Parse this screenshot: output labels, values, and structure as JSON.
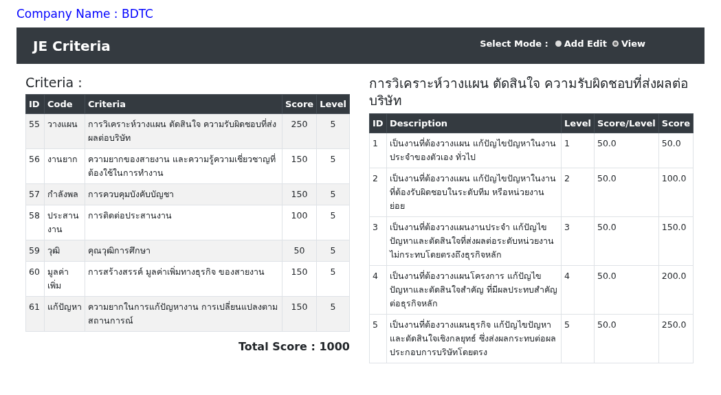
{
  "company": "Company Name : BDTC",
  "header": {
    "title": "JE Criteria",
    "mode_label": "Select Mode :",
    "modes": [
      {
        "label": "Add Edit",
        "selected": false
      },
      {
        "label": "View",
        "selected": true
      }
    ]
  },
  "criteria": {
    "title": "Criteria :",
    "columns": [
      "ID",
      "Code",
      "Criteria",
      "Score",
      "Level"
    ],
    "rows": [
      [
        "55",
        "วางแผน",
        "การวิเคราะห์วางแผน ตัดสินใจ ความรับผิดชอบที่ส่งผลต่อบริษัท",
        "250",
        "5"
      ],
      [
        "56",
        "งานยาก",
        "ความยากของสายงาน และความรู้ความเชี่ยวชาญที่ต้องใช้ในการทำงาน",
        "150",
        "5"
      ],
      [
        "57",
        "กำลังพล",
        "การควบคุมบังคับบัญชา",
        "150",
        "5"
      ],
      [
        "58",
        "ประสานงาน",
        "การติดต่อประสานงาน",
        "100",
        "5"
      ],
      [
        "59",
        "วุฒิ",
        "คุณวุฒิการศึกษา",
        "50",
        "5"
      ],
      [
        "60",
        "มูลค่าเพิ่ม",
        "การสร้างสรรค์ มูลค่าเพิ่มทางธุรกิจ ของสายงาน",
        "150",
        "5"
      ],
      [
        "61",
        "แก้ปัญหา",
        "ความยากในการแก้ปัญหางาน การเปลี่ยนแปลงตามสถานการณ์",
        "150",
        "5"
      ]
    ],
    "total": "Total Score : 1000"
  },
  "levels": {
    "title": "การวิเคราะห์วางแผน ตัดสินใจ ความรับผิดชอบที่ส่งผลต่อบริษัท",
    "columns": [
      "ID",
      "Description",
      "Level",
      "Score/Level",
      "Score"
    ],
    "rows": [
      [
        "1",
        "เป็นงานที่ต้องวางแผน แก้ปัญไขปัญหาในงานประจำของตัวเอง ทั่วไป",
        "1",
        "50.0",
        "50.0"
      ],
      [
        "2",
        "เป็นงานที่ต้องวางแผน แก้ปัญไขปัญหาในงานที่ต้องรับผิดชอบในระดับทีม หรือหน่วยงานย่อย",
        "2",
        "50.0",
        "100.0"
      ],
      [
        "3",
        "เป็นงานที่ต้องวางแผนงานประจำ แก้ปัญไขปัญหาและตัดสินใจที่ส่งผลต่อระดับหน่วยงาน ไม่กระทบโดยตรงถึงธุรกิจหลัก",
        "3",
        "50.0",
        "150.0"
      ],
      [
        "4",
        "เป็นงานที่ต้องวางแผนโครงการ แก้ปัญไขปัญหาและตัดสินใจสำคัญ ที่มีผลประทบสำคัญต่อธุรกิจหลัก",
        "4",
        "50.0",
        "200.0"
      ],
      [
        "5",
        "เป็นงานที่ต้องวางแผนธุรกิจ แก้ปัญไขปัญหาและตัดสินใจเชิงกลยุทธ์ ซึ่งส่งผลกระทบต่อผลประกอบการบริษัทโดยตรง",
        "5",
        "50.0",
        "250.0"
      ]
    ]
  }
}
